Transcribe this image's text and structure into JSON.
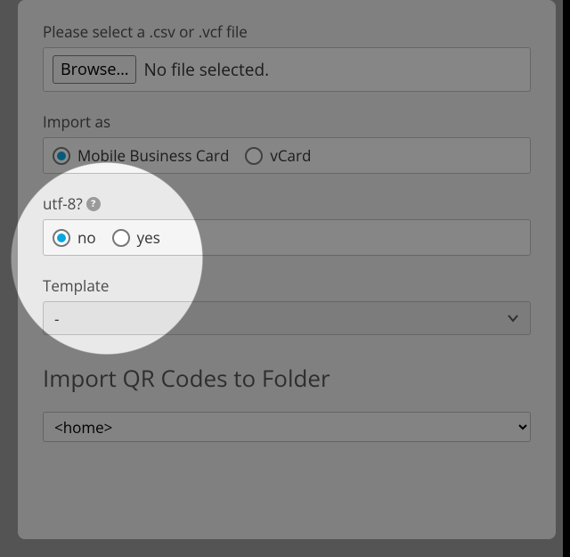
{
  "file": {
    "label": "Please select a .csv or .vcf file",
    "browse": "Browse…",
    "status": "No file selected."
  },
  "importAs": {
    "label": "Import as",
    "options": [
      {
        "label": "Mobile Business Card",
        "selected": true
      },
      {
        "label": "vCard",
        "selected": false
      }
    ]
  },
  "utf8": {
    "label": "utf-8?",
    "options": [
      {
        "label": "no",
        "selected": true
      },
      {
        "label": "yes",
        "selected": false
      }
    ]
  },
  "template": {
    "label": "Template",
    "selected": "-"
  },
  "folder": {
    "heading": "Import QR Codes to Folder",
    "selected": "<home>"
  }
}
